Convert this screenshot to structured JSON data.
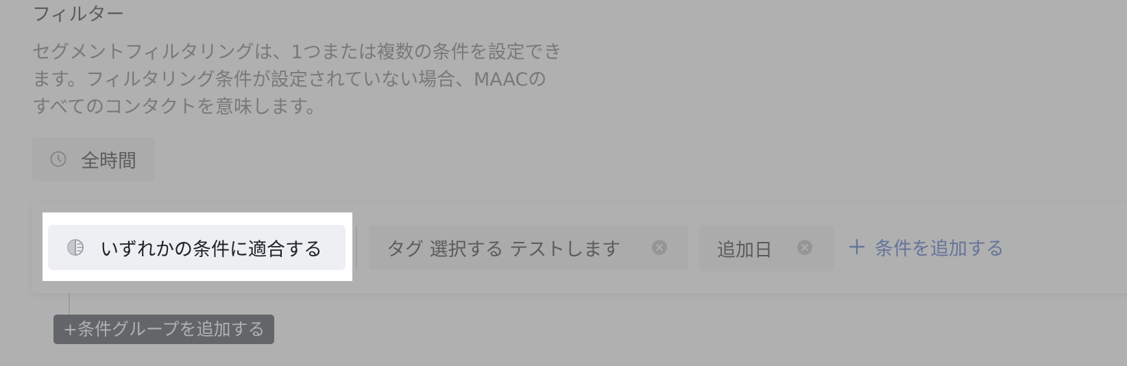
{
  "filter": {
    "title": "フィルター",
    "description": "セグメントフィルタリングは、1つまたは複数の条件を設定でき\nます。フィルタリング条件が設定されていない場合、MAACの\nすべてのコンタクトを意味します。",
    "time_button": {
      "label": "全時間",
      "icon": "clock-icon"
    },
    "conditions": {
      "match_chip": {
        "label": "いずれかの条件に適合する",
        "icon": "half-circle-icon"
      },
      "tag_chip": {
        "label": "タグ 選択する テストします",
        "clear_icon": "clear-circle-icon"
      },
      "date_chip": {
        "label": "追加日",
        "clear_icon": "clear-circle-icon"
      },
      "add_condition": {
        "label": "条件を追加する",
        "icon": "plus-icon"
      }
    },
    "add_group_button": {
      "label": "+条件グループを追加する"
    }
  },
  "colors": {
    "accent_link": "#3b63c4",
    "chip_background": "#f1f2f4",
    "overlay": "rgba(128,128,128,0.62)",
    "dark_button": "#353b45"
  }
}
